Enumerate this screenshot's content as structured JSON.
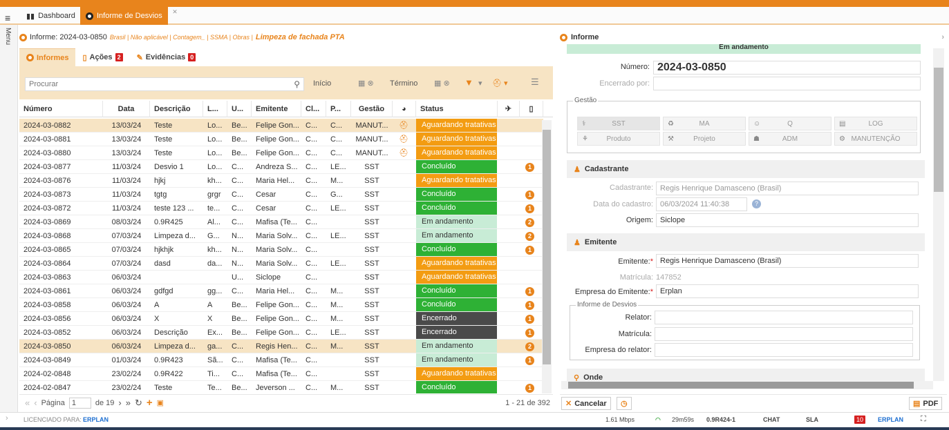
{
  "app": {
    "menu_label": "Menu",
    "tabs": [
      {
        "label": "Dashboard"
      },
      {
        "label": "Informe de Desvios"
      }
    ]
  },
  "report_header": {
    "prefix": "Informe: 2024-03-0850",
    "meta": "Brasil | Não aplicável | Contagem_ | SSMA | Obras |",
    "title": "Limpeza de fachada PTA"
  },
  "subtabs": [
    {
      "label": "Informes",
      "badge": ""
    },
    {
      "label": "Ações",
      "badge": "2"
    },
    {
      "label": "Evidências",
      "badge": "0"
    }
  ],
  "filters": {
    "search_placeholder": "Procurar",
    "start_label": "Início",
    "end_label": "Término"
  },
  "table": {
    "columns": [
      "Número",
      "Data",
      "Descrição",
      "L...",
      "U...",
      "Emitente",
      "Cl...",
      "P...",
      "Gestão",
      "",
      "Status",
      "",
      ""
    ],
    "rows": [
      {
        "numero": "2024-03-0882",
        "data": "13/03/24",
        "descricao": "Teste",
        "l": "Lo...",
        "u": "Be...",
        "emitente": "Felipe Gon...",
        "cl": "C...",
        "p": "C...",
        "gestao": "MANUT...",
        "hat": true,
        "status": "Aguardando tratativas",
        "status_color": "#f39c12",
        "ord": "",
        "selected": true
      },
      {
        "numero": "2024-03-0881",
        "data": "13/03/24",
        "descricao": "Teste",
        "l": "Lo...",
        "u": "Be...",
        "emitente": "Felipe Gon...",
        "cl": "C...",
        "p": "C...",
        "gestao": "MANUT...",
        "hat": true,
        "status": "Aguardando tratativas",
        "status_color": "#f39c12",
        "ord": "",
        "selected": false
      },
      {
        "numero": "2024-03-0880",
        "data": "13/03/24",
        "descricao": "Teste",
        "l": "Lo...",
        "u": "Be...",
        "emitente": "Felipe Gon...",
        "cl": "C...",
        "p": "C...",
        "gestao": "MANUT...",
        "hat": true,
        "status": "Aguardando tratativas",
        "status_color": "#f39c12",
        "ord": "",
        "selected": false
      },
      {
        "numero": "2024-03-0877",
        "data": "11/03/24",
        "descricao": "Desvio 1",
        "l": "Lo...",
        "u": "C...",
        "emitente": "Andreza S...",
        "cl": "C...",
        "p": "LE...",
        "gestao": "SST",
        "hat": false,
        "status": "Concluído",
        "status_color": "#2eb135",
        "ord": "1",
        "selected": false
      },
      {
        "numero": "2024-03-0876",
        "data": "11/03/24",
        "descricao": "hjkj",
        "l": "kh...",
        "u": "C...",
        "emitente": "Maria Hel...",
        "cl": "C...",
        "p": "M...",
        "gestao": "SST",
        "hat": false,
        "status": "Aguardando tratativas",
        "status_color": "#f39c12",
        "ord": "",
        "selected": false
      },
      {
        "numero": "2024-03-0873",
        "data": "11/03/24",
        "descricao": "tgtg",
        "l": "grgr",
        "u": "C...",
        "emitente": "Cesar",
        "cl": "C...",
        "p": "G...",
        "gestao": "SST",
        "hat": false,
        "status": "Concluído",
        "status_color": "#2eb135",
        "ord": "1",
        "selected": false
      },
      {
        "numero": "2024-03-0872",
        "data": "11/03/24",
        "descricao": "teste 123 ...",
        "l": "te...",
        "u": "C...",
        "emitente": "Cesar",
        "cl": "C...",
        "p": "LE...",
        "gestao": "SST",
        "hat": false,
        "status": "Concluído",
        "status_color": "#2eb135",
        "ord": "1",
        "selected": false
      },
      {
        "numero": "2024-03-0869",
        "data": "08/03/24",
        "descricao": "0.9R425",
        "l": "Al...",
        "u": "C...",
        "emitente": "Mafisa (Te...",
        "cl": "C...",
        "p": "",
        "gestao": "SST",
        "hat": false,
        "status": "Em andamento",
        "status_color": "#c8ecd6",
        "ord": "2",
        "selected": false
      },
      {
        "numero": "2024-03-0868",
        "data": "07/03/24",
        "descricao": "Limpeza d...",
        "l": "G...",
        "u": "N...",
        "emitente": "Maria Solv...",
        "cl": "C...",
        "p": "LE...",
        "gestao": "SST",
        "hat": false,
        "status": "Em andamento",
        "status_color": "#c8ecd6",
        "ord": "2",
        "selected": false
      },
      {
        "numero": "2024-03-0865",
        "data": "07/03/24",
        "descricao": "hjkhjk",
        "l": "kh...",
        "u": "N...",
        "emitente": "Maria Solv...",
        "cl": "C...",
        "p": "",
        "gestao": "SST",
        "hat": false,
        "status": "Concluído",
        "status_color": "#2eb135",
        "ord": "1",
        "selected": false
      },
      {
        "numero": "2024-03-0864",
        "data": "07/03/24",
        "descricao": "dasd",
        "l": "da...",
        "u": "N...",
        "emitente": "Maria Solv...",
        "cl": "C...",
        "p": "LE...",
        "gestao": "SST",
        "hat": false,
        "status": "Aguardando tratativas",
        "status_color": "#f39c12",
        "ord": "",
        "selected": false
      },
      {
        "numero": "2024-03-0863",
        "data": "06/03/24",
        "descricao": "",
        "l": "",
        "u": "U...",
        "emitente": "Siclope",
        "cl": "C...",
        "p": "",
        "gestao": "SST",
        "hat": false,
        "status": "Aguardando tratativas",
        "status_color": "#f39c12",
        "ord": "",
        "selected": false
      },
      {
        "numero": "2024-03-0861",
        "data": "06/03/24",
        "descricao": "gdfgd",
        "l": "gg...",
        "u": "C...",
        "emitente": "Maria Hel...",
        "cl": "C...",
        "p": "M...",
        "gestao": "SST",
        "hat": false,
        "status": "Concluído",
        "status_color": "#2eb135",
        "ord": "1",
        "selected": false
      },
      {
        "numero": "2024-03-0858",
        "data": "06/03/24",
        "descricao": "A",
        "l": "A",
        "u": "Be...",
        "emitente": "Felipe Gon...",
        "cl": "C...",
        "p": "M...",
        "gestao": "SST",
        "hat": false,
        "status": "Concluído",
        "status_color": "#2eb135",
        "ord": "1",
        "selected": false
      },
      {
        "numero": "2024-03-0856",
        "data": "06/03/24",
        "descricao": "X",
        "l": "X",
        "u": "Be...",
        "emitente": "Felipe Gon...",
        "cl": "C...",
        "p": "M...",
        "gestao": "SST",
        "hat": false,
        "status": "Encerrado",
        "status_color": "#4a4a4a",
        "ord": "1",
        "selected": false
      },
      {
        "numero": "2024-03-0852",
        "data": "06/03/24",
        "descricao": "Descrição",
        "l": "Ex...",
        "u": "Be...",
        "emitente": "Felipe Gon...",
        "cl": "C...",
        "p": "LE...",
        "gestao": "SST",
        "hat": false,
        "status": "Encerrado",
        "status_color": "#4a4a4a",
        "ord": "1",
        "selected": false
      },
      {
        "numero": "2024-03-0850",
        "data": "06/03/24",
        "descricao": "Limpeza d...",
        "l": "ga...",
        "u": "C...",
        "emitente": "Regis Hen...",
        "cl": "C...",
        "p": "M...",
        "gestao": "SST",
        "hat": false,
        "status": "Em andamento",
        "status_color": "#c8ecd6",
        "ord": "2",
        "selected": true
      },
      {
        "numero": "2024-03-0849",
        "data": "01/03/24",
        "descricao": "0.9R423",
        "l": "Sã...",
        "u": "C...",
        "emitente": "Mafisa (Te...",
        "cl": "C...",
        "p": "",
        "gestao": "SST",
        "hat": false,
        "status": "Em andamento",
        "status_color": "#c8ecd6",
        "ord": "1",
        "selected": false
      },
      {
        "numero": "2024-02-0848",
        "data": "23/02/24",
        "descricao": "0.9R422",
        "l": "Ti...",
        "u": "C...",
        "emitente": "Mafisa (Te...",
        "cl": "C...",
        "p": "",
        "gestao": "SST",
        "hat": false,
        "status": "Aguardando tratativas",
        "status_color": "#f39c12",
        "ord": "",
        "selected": false
      },
      {
        "numero": "2024-02-0847",
        "data": "23/02/24",
        "descricao": "Teste",
        "l": "Te...",
        "u": "Be...",
        "emitente": "Jeverson ...",
        "cl": "C...",
        "p": "M...",
        "gestao": "SST",
        "hat": false,
        "status": "Concluído",
        "status_color": "#2eb135",
        "ord": "1",
        "selected": false
      }
    ]
  },
  "pager": {
    "page_label": "Página",
    "page_value": "1",
    "of_label": "de 19",
    "count_label": "1 - 21 de 392"
  },
  "right": {
    "title": "Informe",
    "banner": "Em andamento",
    "numero_label": "Número:",
    "numero_value": "2024-03-0850",
    "encerrado_label": "Encerrado por:",
    "gestao_legend": "Gestão",
    "gestao_buttons": [
      {
        "label": "SST",
        "icon": "⚕"
      },
      {
        "label": "MA",
        "icon": "♻"
      },
      {
        "label": "Q",
        "icon": "☺"
      },
      {
        "label": "LOG",
        "icon": "▤"
      },
      {
        "label": "Produto",
        "icon": "⚘"
      },
      {
        "label": "Projeto",
        "icon": "⚒"
      },
      {
        "label": "ADM",
        "icon": "☗"
      },
      {
        "label": "MANUTENÇÃO",
        "icon": "⚙"
      }
    ],
    "cadastrante_section": "Cadastrante",
    "cadastrante_label": "Cadastrante:",
    "cadastrante_value": "Regis Henrique Damasceno (Brasil)",
    "data_cadastro_label": "Data do cadastro:",
    "data_cadastro_value": "06/03/2024 11:40:38",
    "origem_label": "Origem:",
    "origem_value": "Siclope",
    "emitente_section": "Emitente",
    "emitente_label": "Emitente:",
    "emitente_value": "Regis Henrique Damasceno (Brasil)",
    "matricula_label": "Matrícula:",
    "matricula_value": "147852",
    "empresa_emitente_label": "Empresa do Emitente:",
    "empresa_emitente_value": "Erplan",
    "informe_legend": "Informe de Desvios",
    "relator_label": "Relator:",
    "matricula2_label": "Matrícula:",
    "empresa_relator_label": "Empresa do relator:",
    "onde_section": "Onde",
    "cancel_label": "Cancelar",
    "pdf_label": "PDF"
  },
  "statusbar": {
    "licensed": "LICENCIADO PARA:",
    "brand": "ERPLAN",
    "speed": "1.61 Mbps",
    "timer": "29m59s",
    "version": "0.9R424-1",
    "chat": "CHAT",
    "sla": "SLA",
    "notif": "10",
    "brand2": "ERPLAN"
  }
}
